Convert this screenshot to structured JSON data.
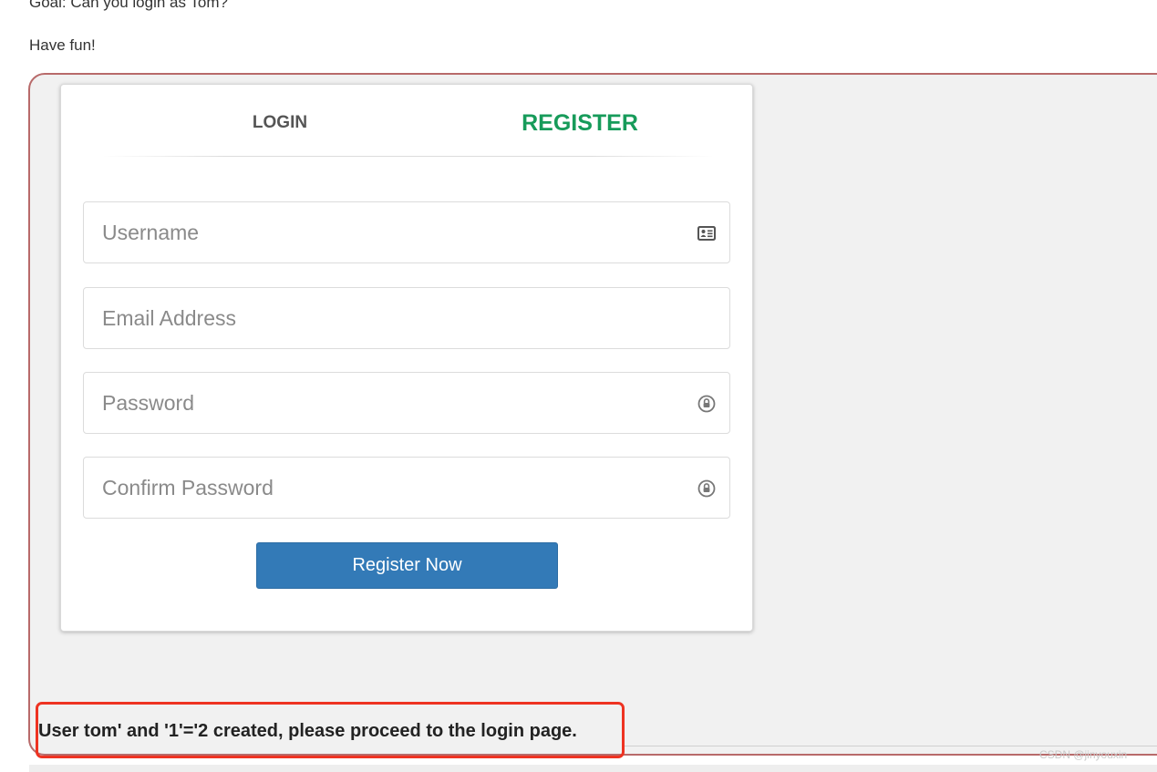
{
  "intro": {
    "goal": "Goal: Can you login as Tom?",
    "have_fun": "Have fun!"
  },
  "tabs": {
    "login": "LOGIN",
    "register": "REGISTER",
    "active": "register"
  },
  "form": {
    "username_placeholder": "Username",
    "email_placeholder": "Email Address",
    "password_placeholder": "Password",
    "confirm_password_placeholder": "Confirm Password",
    "submit_label": "Register Now"
  },
  "feedback": {
    "message": "User tom' and '1'='2 created, please proceed to the login page."
  },
  "watermark": "CSDN @jinyouxin",
  "colors": {
    "register_tab": "#179b5a",
    "button": "#337ab7",
    "container_border": "#b86a6a",
    "highlight_border": "#ee3322"
  }
}
